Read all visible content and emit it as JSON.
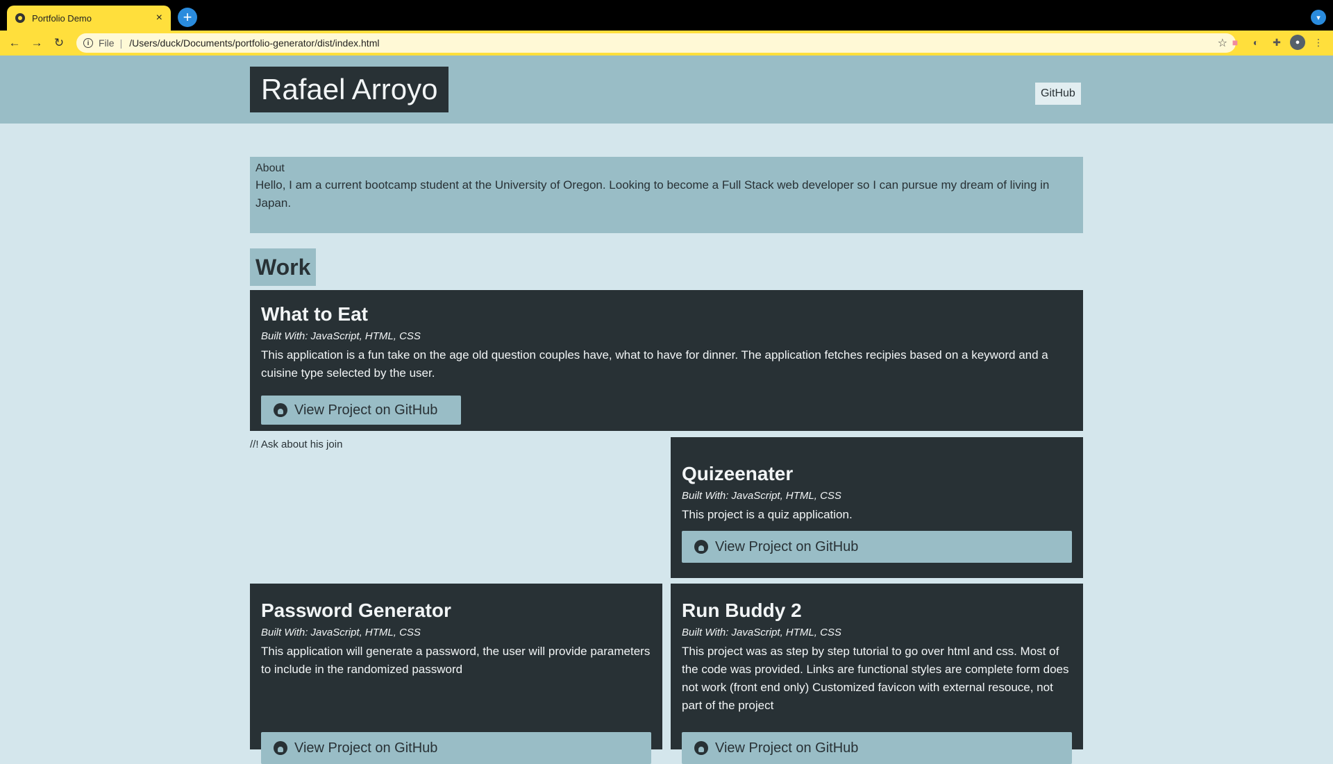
{
  "browser": {
    "tab_title": "Portfolio Demo",
    "tab_close": "×",
    "new_tab": "+",
    "url_scheme": "File",
    "url_sep": "|",
    "url": "/Users/duck/Documents/portfolio-generator/dist/index.html"
  },
  "header": {
    "title": "Rafael Arroyo",
    "github_link": "GitHub"
  },
  "about": {
    "heading": "About",
    "text": "Hello, I am a current bootcamp student at the University of Oregon. Looking to become a Full Stack web developer so I can pursue my dream of living in Japan."
  },
  "work": {
    "heading": "Work",
    "note": "//! Ask about his join",
    "button_label": "View Project on GitHub",
    "projects": [
      {
        "title": "What to Eat",
        "built_with": "Built With: JavaScript, HTML, CSS",
        "description": "This application is a fun take on the age old question couples have, what to have for dinner. The application fetches recipies based on a keyword and a cuisine type selected by the user."
      },
      {
        "title": "Quizeenater",
        "built_with": "Built With: JavaScript, HTML, CSS",
        "description": "This project is a quiz application."
      },
      {
        "title": "Password Generator",
        "built_with": "Built With: JavaScript, HTML, CSS",
        "description": "This application will generate a password, the user will provide parameters to include in the randomized password"
      },
      {
        "title": "Run Buddy 2",
        "built_with": "Built With: JavaScript, HTML, CSS",
        "description": "This project was as step by step tutorial to go over html and css. Most of the code was provided. Links are functional styles are complete form does not work (front end only) Customized favicon with external resouce, not part of the project"
      }
    ]
  }
}
